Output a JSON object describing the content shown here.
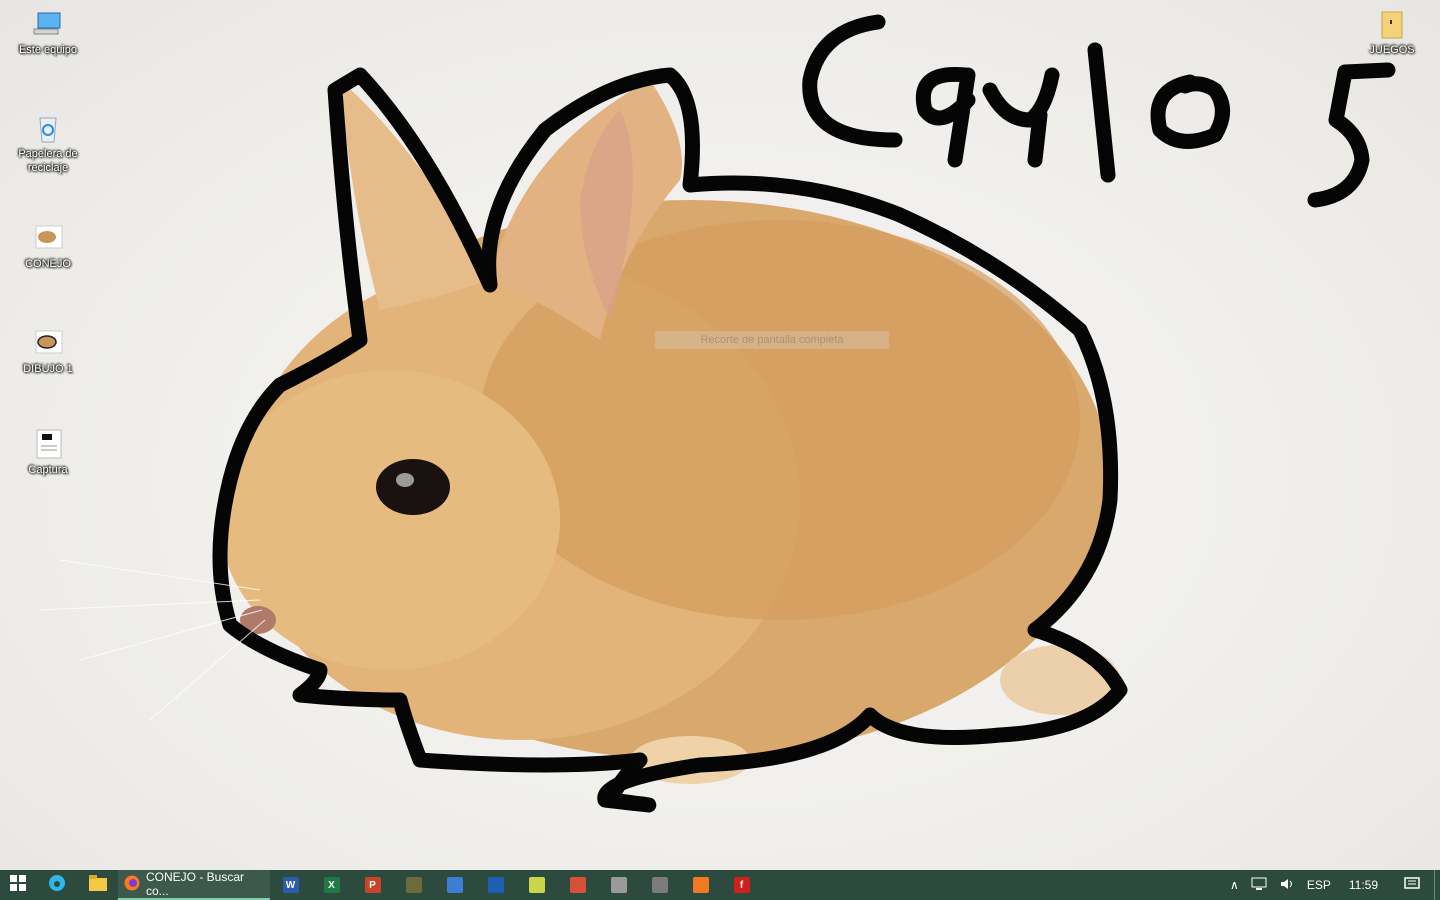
{
  "desktop": {
    "icons": [
      {
        "label": "Este equipo",
        "icon": "computer-icon"
      },
      {
        "label": "Papelera de reciclaje",
        "icon": "recycle-bin-icon"
      },
      {
        "label": "CONEJO",
        "icon": "image-file-icon"
      },
      {
        "label": "DIBUJO 1",
        "icon": "image-file-icon"
      },
      {
        "label": "Captura",
        "icon": "image-file-icon"
      },
      {
        "label": "JUEGOS",
        "icon": "folder-icon"
      }
    ],
    "wallpaper_text": "Carlos",
    "overlay_text": "Recorte de pantalla completa"
  },
  "taskbar": {
    "firefox_window_title": "CONEJO - Buscar co...",
    "pinned_apps": [
      "start-icon",
      "edge-icon",
      "file-explorer-icon",
      "firefox-icon",
      "word-icon",
      "excel-icon",
      "powerpoint-icon",
      "app-icon",
      "app-icon",
      "app-icon",
      "notepad-icon",
      "paint-icon",
      "app-icon",
      "app-icon",
      "xampp-icon",
      "flash-icon"
    ],
    "tray": {
      "language": "ESP",
      "time": "11:59"
    },
    "colors": {
      "background": "#2d4a3e",
      "active_underline": "#7fd3a8"
    }
  }
}
